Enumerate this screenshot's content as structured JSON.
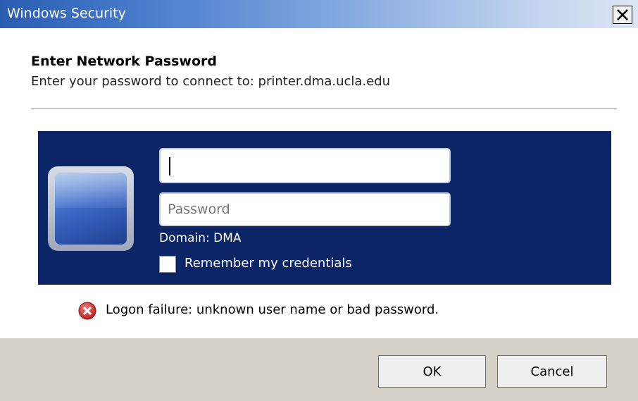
{
  "window": {
    "title": "Windows Security",
    "close_label": "Close"
  },
  "dialog": {
    "heading": "Enter Network Password",
    "subheading": "Enter your password to connect to: printer.dma.ucla.edu"
  },
  "credentials": {
    "username_value": "",
    "password_placeholder": "Password",
    "domain_text": "Domain: DMA",
    "remember_label": "Remember my credentials",
    "remember_checked": false
  },
  "error": {
    "message": "Logon failure: unknown user name or bad password.",
    "icon": "error-x-icon",
    "color": "#cc2a2a"
  },
  "buttons": {
    "ok_label": "OK",
    "cancel_label": "Cancel"
  },
  "colors": {
    "panel": "#0c2566",
    "footer": "#d4d0c8",
    "titlebar_start": "#2a5cb2"
  }
}
